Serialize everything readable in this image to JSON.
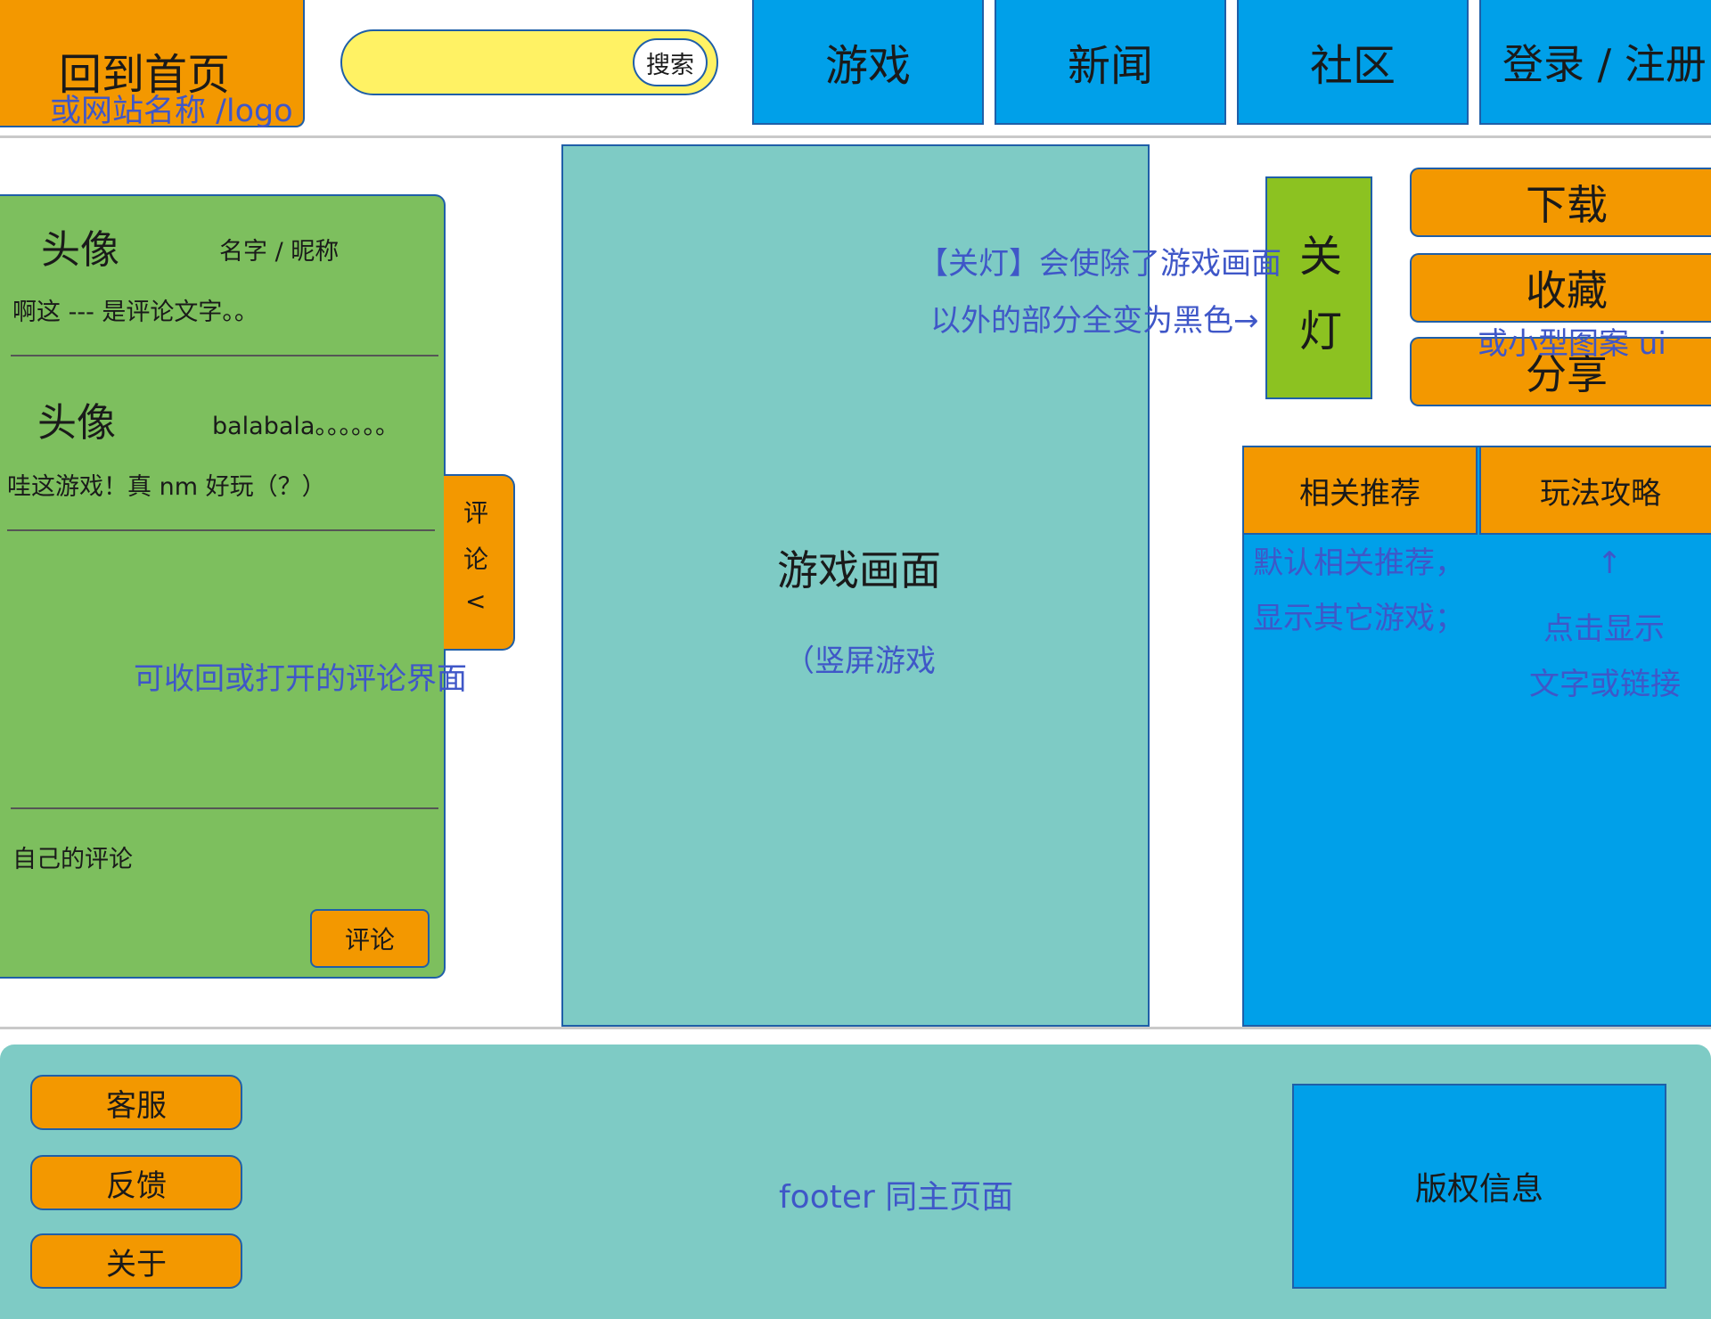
{
  "header": {
    "home_label": "回到首页",
    "home_note": "或网站名称 /logo",
    "search_value": "",
    "search_button": "搜索",
    "nav": [
      "游戏",
      "新闻",
      "社区",
      "登录 / 注册"
    ]
  },
  "comments": {
    "items": [
      {
        "avatar": "头像",
        "name": "名字 / 昵称",
        "text": "啊这 --- 是评论文字。。"
      },
      {
        "avatar": "头像",
        "name": "balabala。。。。。。",
        "text": "哇这游戏！真 nm 好玩（？）"
      }
    ],
    "note": "可收回或打开的评论界面",
    "own_comment_label": "自己的评论",
    "submit_label": "评论",
    "toggle_label": [
      "评",
      "论",
      "<"
    ]
  },
  "game": {
    "title": "游戏画面",
    "subtitle": "（竖屏游戏"
  },
  "lights": {
    "button_chars": [
      "关",
      "灯"
    ],
    "note_line1": "【关灯】会使除了游戏画面",
    "note_line2": "以外的部分全变为黑色→"
  },
  "actions": {
    "download": "下载",
    "favorite": "收藏",
    "share": "分享",
    "note": "或小型图案 ui"
  },
  "side_panel": {
    "tabs": [
      "相关推荐",
      "玩法攻略"
    ],
    "note_left": [
      "默认相关推荐，",
      "显示其它游戏；"
    ],
    "note_arrow": "↑",
    "note_right": [
      "点击显示",
      "文字或链接"
    ]
  },
  "footer": {
    "buttons": [
      "客服",
      "反馈",
      "关于"
    ],
    "note": "footer 同主页面",
    "copyright": "版权信息"
  },
  "colors": {
    "orange": "#f39800",
    "blue": "#00a0e9",
    "green": "#7dbf5e",
    "teal": "#7ecbc5",
    "yellow": "#fff264",
    "lime": "#8cc221",
    "annotation": "#3f57c8"
  }
}
